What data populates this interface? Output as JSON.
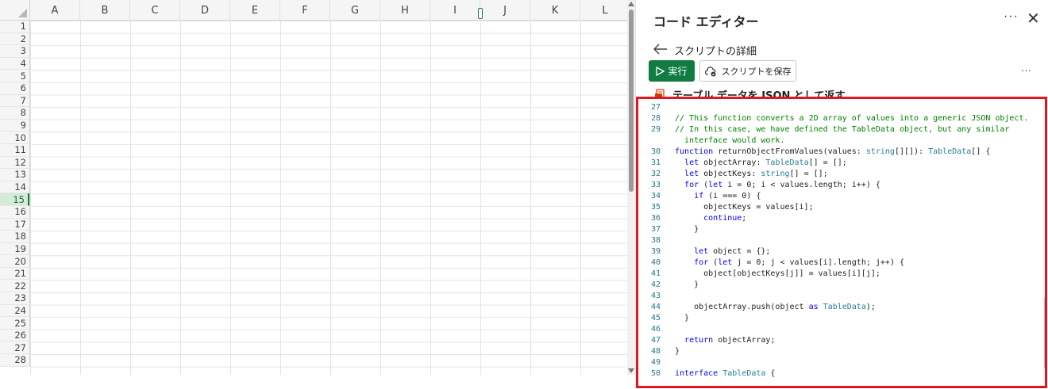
{
  "spreadsheet": {
    "columns": [
      "A",
      "B",
      "C",
      "D",
      "E",
      "F",
      "G",
      "H",
      "I",
      "J",
      "K",
      "L"
    ],
    "rows": [
      "1",
      "2",
      "3",
      "4",
      "5",
      "6",
      "7",
      "8",
      "9",
      "10",
      "11",
      "12",
      "13",
      "14",
      "15",
      "16",
      "17",
      "18",
      "19",
      "20",
      "21",
      "22",
      "23",
      "24",
      "25",
      "26",
      "27",
      "28"
    ],
    "selected_row": "15"
  },
  "editor": {
    "title": "コード エディター",
    "more_label": "···",
    "close_label": "✕",
    "back_label": "スクリプトの詳細",
    "run_label": "実行",
    "save_label": "スクリプトを保存",
    "toolbar_more": "···",
    "script_name": "テーブル データを JSON として返す",
    "accent_color": "#107c41",
    "highlight_color": "#e0171e"
  },
  "code_lines": [
    {
      "n": "27",
      "t": ""
    },
    {
      "n": "28",
      "t": "// This function converts a 2D array of values into a generic JSON object.",
      "c": "cmt"
    },
    {
      "n": "29",
      "t": "// In this case, we have defined the TableData object, but any similar",
      "c": "cmt"
    },
    {
      "n": "",
      "t": "  interface would work.",
      "c": "cmt"
    },
    {
      "n": "30",
      "t": "function returnObjectFromValues(values: string[][]): TableData[] {"
    },
    {
      "n": "31",
      "t": "  let objectArray: TableData[] = [];"
    },
    {
      "n": "32",
      "t": "  let objectKeys: string[] = [];"
    },
    {
      "n": "33",
      "t": "  for (let i = 0; i < values.length; i++) {"
    },
    {
      "n": "34",
      "t": "    if (i === 0) {"
    },
    {
      "n": "35",
      "t": "      objectKeys = values[i];"
    },
    {
      "n": "36",
      "t": "      continue;"
    },
    {
      "n": "37",
      "t": "    }"
    },
    {
      "n": "38",
      "t": ""
    },
    {
      "n": "39",
      "t": "    let object = {};"
    },
    {
      "n": "40",
      "t": "    for (let j = 0; j < values[i].length; j++) {"
    },
    {
      "n": "41",
      "t": "      object[objectKeys[j]] = values[i][j];"
    },
    {
      "n": "42",
      "t": "    }"
    },
    {
      "n": "43",
      "t": ""
    },
    {
      "n": "44",
      "t": "    objectArray.push(object as TableData);"
    },
    {
      "n": "45",
      "t": "  }"
    },
    {
      "n": "46",
      "t": ""
    },
    {
      "n": "47",
      "t": "  return objectArray;"
    },
    {
      "n": "48",
      "t": "}"
    },
    {
      "n": "49",
      "t": ""
    },
    {
      "n": "50",
      "t": "interface TableData {"
    }
  ]
}
